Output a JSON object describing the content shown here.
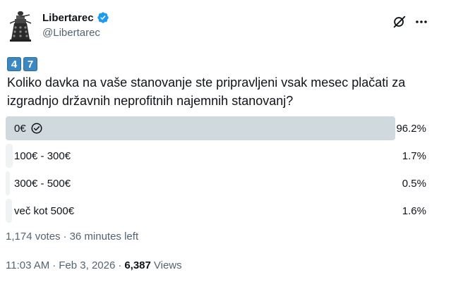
{
  "author": {
    "display_name": "Libertarec",
    "handle": "@Libertarec"
  },
  "keycaps": [
    "4",
    "7"
  ],
  "question_lines": [
    "Koliko davka na vaše stanovanje ste pripravljeni vsak mesec plačati za",
    "izgradnjo državnih neprofitnih najemnih stanovanj?"
  ],
  "poll": {
    "options": [
      {
        "label": "0€",
        "percent_text": "96.2%",
        "percent": 96.2,
        "selected": true
      },
      {
        "label": "100€ - 300€",
        "percent_text": "1.7%",
        "percent": 1.7,
        "selected": false
      },
      {
        "label": "300€ - 500€",
        "percent_text": "0.5%",
        "percent": 0.5,
        "selected": false
      },
      {
        "label": "več kot 500€",
        "percent_text": "1.6%",
        "percent": 1.6,
        "selected": false
      }
    ],
    "votes": "1,174 votes",
    "separator": "·",
    "time_left": "36 minutes left"
  },
  "meta": {
    "time": "11:03 AM",
    "date": "Feb 3, 2026",
    "separator": "·",
    "views_count": "6,387",
    "views_label": "Views"
  },
  "colors": {
    "verified": "#1d9bf0",
    "winner_bar": "#cfd9de",
    "loser_bar": "#eff3f4",
    "keycap": "#3b88c3"
  },
  "icons": [
    "dalek-avatar",
    "verified-badge-icon",
    "grok-icon",
    "more-icon",
    "check-circle-icon"
  ]
}
